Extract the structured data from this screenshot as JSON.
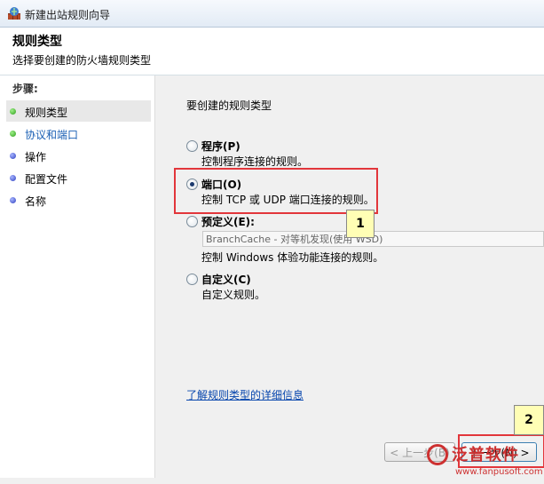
{
  "window": {
    "title": "新建出站规则向导"
  },
  "header": {
    "title": "规则类型",
    "subtitle": "选择要创建的防火墙规则类型"
  },
  "sidebar": {
    "title": "步骤:",
    "items": [
      {
        "label": "规则类型",
        "state": "current"
      },
      {
        "label": "协议和端口",
        "state": "link"
      },
      {
        "label": "操作",
        "state": "pending"
      },
      {
        "label": "配置文件",
        "state": "pending"
      },
      {
        "label": "名称",
        "state": "pending"
      }
    ]
  },
  "main": {
    "question": "要创建的规则类型",
    "options": [
      {
        "label": "程序(P)",
        "desc": "控制程序连接的规则。",
        "checked": false
      },
      {
        "label": "端口(O)",
        "desc": "控制 TCP 或 UDP 端口连接的规则。",
        "checked": true
      },
      {
        "label": "预定义(E):",
        "desc": "控制 Windows 体验功能连接的规则。",
        "checked": false,
        "select_value": "BranchCache - 对等机发现(使用 WSD)"
      },
      {
        "label": "自定义(C)",
        "desc": "自定义规则。",
        "checked": false
      }
    ],
    "learn_link": "了解规则类型的详细信息"
  },
  "buttons": {
    "back": "< 上一步(B)",
    "next": "下一步(N) >"
  },
  "callouts": {
    "one": "1",
    "two": "2"
  },
  "watermark": {
    "text": "泛普软件",
    "url": "www.fanpusoft.com"
  }
}
